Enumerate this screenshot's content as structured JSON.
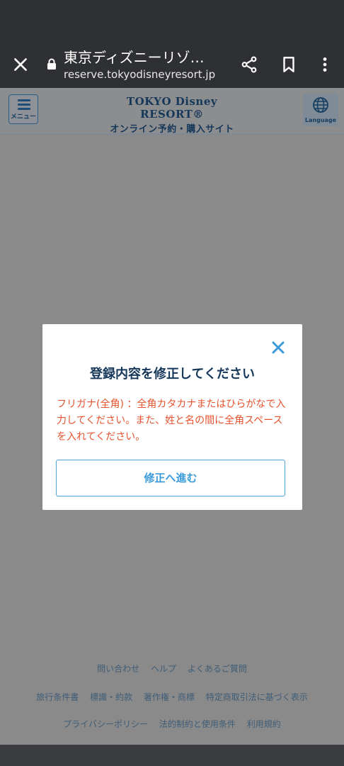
{
  "browser": {
    "page_title": "東京ディズニーリゾ…",
    "url": "reserve.tokyodisneyresort.jp"
  },
  "site_header": {
    "menu_label": "メニュー",
    "logo_line1": "TOKYO Disney RESORT®",
    "logo_line2": "オンライン予約・購入サイト",
    "language_label": "Language"
  },
  "modal": {
    "title": "登録内容を修正してください",
    "message": "フリガナ(全角) ：全角カタカナまたはひらがなで入力してください。また、姓と名の間に全角スペースを入れてください。",
    "action_label": "修正へ進む"
  },
  "footer": {
    "row1": [
      "問い合わせ",
      "ヘルプ",
      "よくあるご質問"
    ],
    "row2": [
      "旅行条件書",
      "標識・約款",
      "著作権・商標",
      "特定商取引法に基づく表示"
    ],
    "row3": [
      "プライバシーポリシー",
      "法的制約と使用条件",
      "利用規約"
    ]
  },
  "colors": {
    "modal_title": "#15375a",
    "error_text": "#e5532e",
    "accent": "#3a9ad9"
  }
}
